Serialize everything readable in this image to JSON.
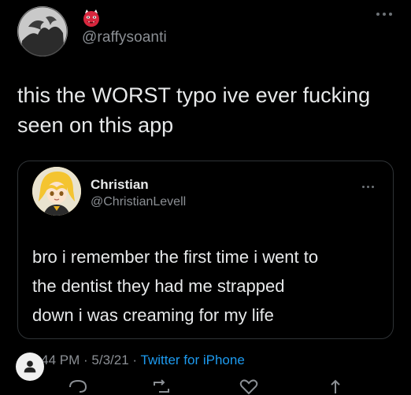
{
  "outer_tweet": {
    "handle": "@raffysoanti",
    "emoji": "ogre-emoji",
    "text": "this the WORST typo ive ever fucking\nseen on this app"
  },
  "quoted_tweet": {
    "name": "Christian",
    "handle": "@ChristianLevell",
    "text": "bro i remember the first time i went to\nthe dentist they had me strapped\ndown i was creaming for my life"
  },
  "meta": {
    "time": "9:44 PM",
    "separator": " · ",
    "date": "5/3/21",
    "source": "Twitter for iPhone"
  },
  "colors": {
    "background": "#000000",
    "text_primary": "#e7e9ea",
    "text_secondary": "#8b8f94",
    "link": "#1d9bf0",
    "border": "#2f3336"
  },
  "icons": {
    "more_outer": "more-horizontal-icon",
    "more_inner": "more-horizontal-icon",
    "reply": "reply-icon",
    "retweet": "retweet-icon",
    "like": "heart-icon",
    "share": "share-icon",
    "profile": "user-icon"
  }
}
